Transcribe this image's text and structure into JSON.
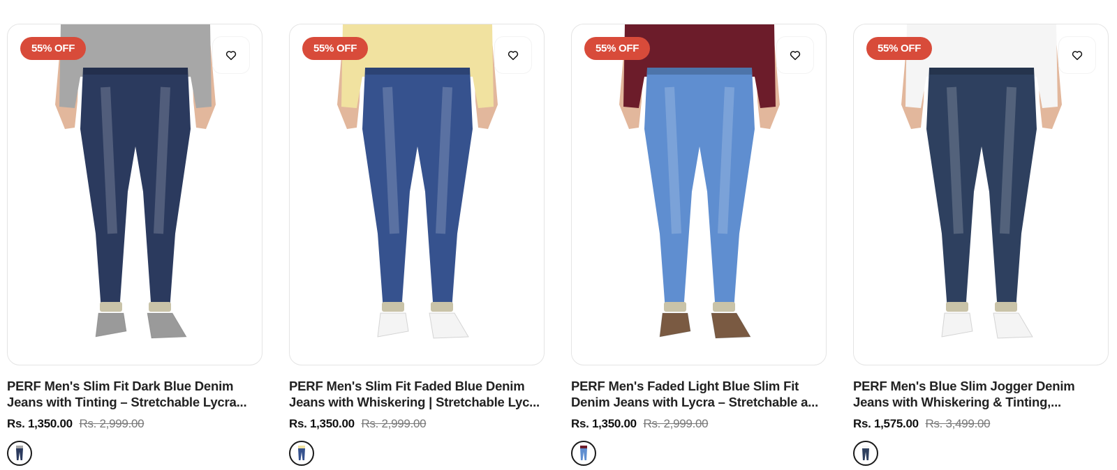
{
  "products": [
    {
      "badge": "55% OFF",
      "title_line1": "PERF Men's Slim Fit Dark Blue Denim",
      "title_line2": "Jeans with Tinting – Stretchable Lycra...",
      "price": "Rs. 1,350.00",
      "mrp": "Rs. 2,999.00",
      "top_color": "#a7a7a7",
      "jeans_color": "#2b3a5e",
      "shoe_color": "#9a9a9a"
    },
    {
      "badge": "55% OFF",
      "title_line1": "PERF Men's Slim Fit Faded Blue Denim",
      "title_line2": "Jeans with Whiskering | Stretchable Lyc...",
      "price": "Rs. 1,350.00",
      "mrp": "Rs. 2,999.00",
      "top_color": "#f1e2a0",
      "jeans_color": "#36528e",
      "shoe_color": "#f4f4f4"
    },
    {
      "badge": "55% OFF",
      "title_line1": "PERF Men's Faded Light Blue Slim Fit",
      "title_line2": "Denim Jeans with Lycra – Stretchable a...",
      "price": "Rs. 1,350.00",
      "mrp": "Rs. 2,999.00",
      "top_color": "#6c1c2a",
      "jeans_color": "#5f8ed0",
      "shoe_color": "#7a5a42"
    },
    {
      "badge": "55% OFF",
      "title_line1": "PERF Men's Blue Slim Jogger Denim",
      "title_line2": "Jeans with Whiskering & Tinting,...",
      "price": "Rs. 1,575.00",
      "mrp": "Rs. 3,499.00",
      "top_color": "#f5f5f5",
      "jeans_color": "#2e405f",
      "shoe_color": "#f4f4f4"
    }
  ],
  "colors": {
    "badge_bg": "#d84b3a",
    "skin": "#e2b79c"
  },
  "icons": {
    "wishlist": "heart-icon",
    "swatch": "jeans-thumbnail-icon"
  }
}
